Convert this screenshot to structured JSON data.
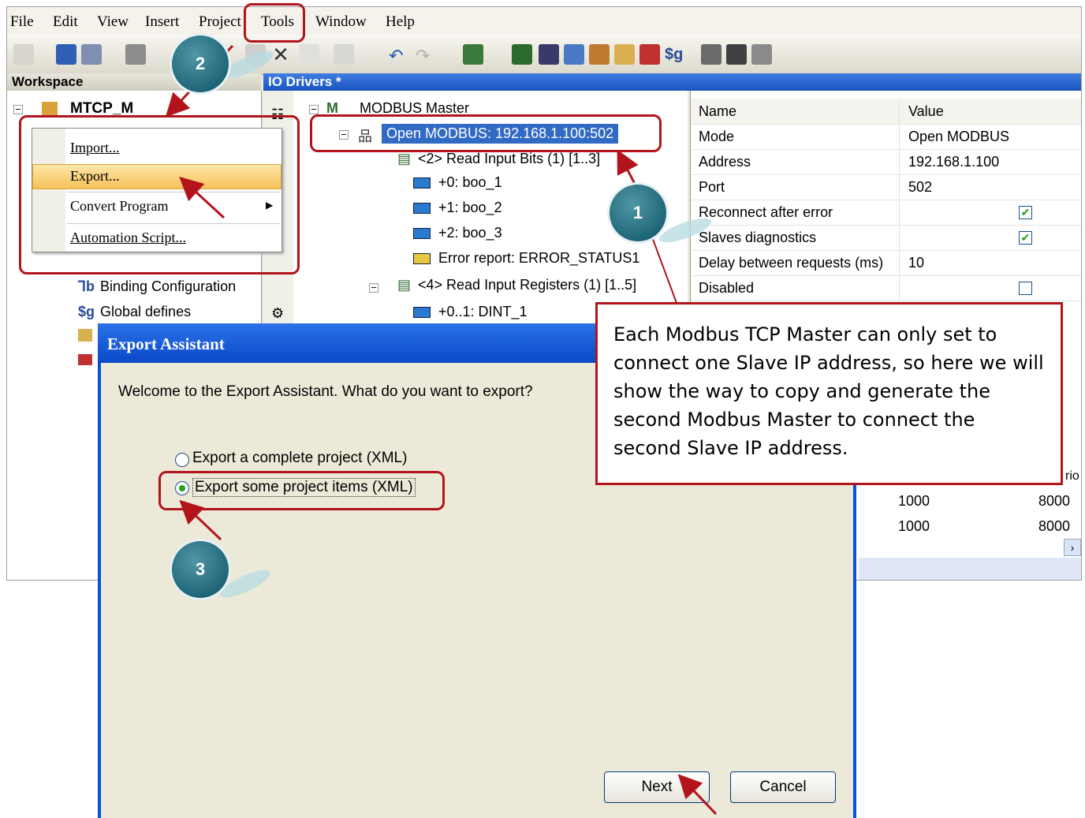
{
  "menu": {
    "file": "File",
    "edit": "Edit",
    "view": "View",
    "insert": "Insert",
    "project": "Project",
    "tools": "Tools",
    "window": "Window",
    "help": "Help"
  },
  "panes": {
    "workspace_title": "Workspace",
    "io_title": "IO Drivers *"
  },
  "workspace": {
    "root": "MTCP_M",
    "binding": "Binding Configuration",
    "globals": "Global defines"
  },
  "context_menu": {
    "import": "Import...",
    "export": "Export...",
    "convert": "Convert Program",
    "automation": "Automation Script..."
  },
  "io_tree": {
    "master": "MODBUS Master",
    "connection": "Open MODBUS: 192.168.1.100:502",
    "read_bits": "<2> Read Input Bits (1) [1..3]",
    "boo1": "+0: boo_1",
    "boo2": "+1: boo_2",
    "boo3": "+2: boo_3",
    "error": "Error report: ERROR_STATUS1",
    "read_regs": "<4> Read Input Registers (1) [1..5]",
    "dint": "+0..1: DINT_1"
  },
  "properties": {
    "header_name": "Name",
    "header_value": "Value",
    "rows": [
      {
        "name": "Mode",
        "value": "Open MODBUS"
      },
      {
        "name": "Address",
        "value": "192.168.1.100"
      },
      {
        "name": "Port",
        "value": "502"
      },
      {
        "name": "Reconnect after error",
        "value": ""
      },
      {
        "name": "Slaves diagnostics",
        "value": ""
      },
      {
        "name": "Delay between requests (ms)",
        "value": "10"
      },
      {
        "name": "Disabled",
        "value": ""
      }
    ],
    "checked": [
      true,
      true,
      false
    ]
  },
  "bg_table": {
    "col_partial": "rio",
    "rows": [
      [
        "1000",
        "8000"
      ],
      [
        "1000",
        "8000"
      ]
    ]
  },
  "dialog": {
    "title": "Export Assistant",
    "prompt": "Welcome to the Export Assistant. What do you want to export?",
    "option1": "Export a complete project (XML)",
    "option2": "Export some project items (XML)",
    "selected": 2,
    "next": "Next",
    "cancel": "Cancel"
  },
  "callout": "Each Modbus TCP Master can only set to connect one Slave IP address, so here we will show the way to copy and generate the second Modbus Master to connect the second Slave IP address.",
  "steps": {
    "one": "1",
    "two": "2",
    "three": "3"
  },
  "colors": {
    "annotation_red": "#b3141c",
    "xp_blue": "#0a52d6",
    "bubble_teal": "#2f7b8d",
    "selection": "#316ac5"
  }
}
